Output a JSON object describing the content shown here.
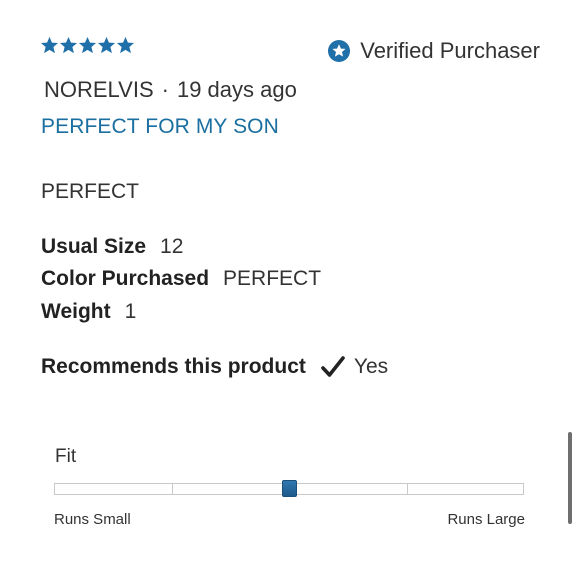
{
  "review": {
    "rating": 5,
    "rating_max": 5,
    "star_color": "#1f6fa8",
    "verified_label": "Verified Purchaser",
    "verified_icon": "star-badge-icon",
    "reviewer": "NORELVIS",
    "separator": "·",
    "posted": "19 days ago",
    "headline": "PERFECT FOR MY SON",
    "headline_color": "#1a6ea0",
    "body": "PERFECT",
    "attributes": [
      {
        "key": "Usual Size",
        "value": "12"
      },
      {
        "key": "Color Purchased",
        "value": "PERFECT"
      },
      {
        "key": "Weight",
        "value": "1"
      }
    ],
    "recommends_label": "Recommends this product",
    "recommends_icon": "checkmark-icon",
    "recommends_value": "Yes"
  },
  "fit": {
    "label": "Fit",
    "low_label": "Runs Small",
    "high_label": "Runs Large",
    "value": 0.5,
    "segments": 4
  }
}
